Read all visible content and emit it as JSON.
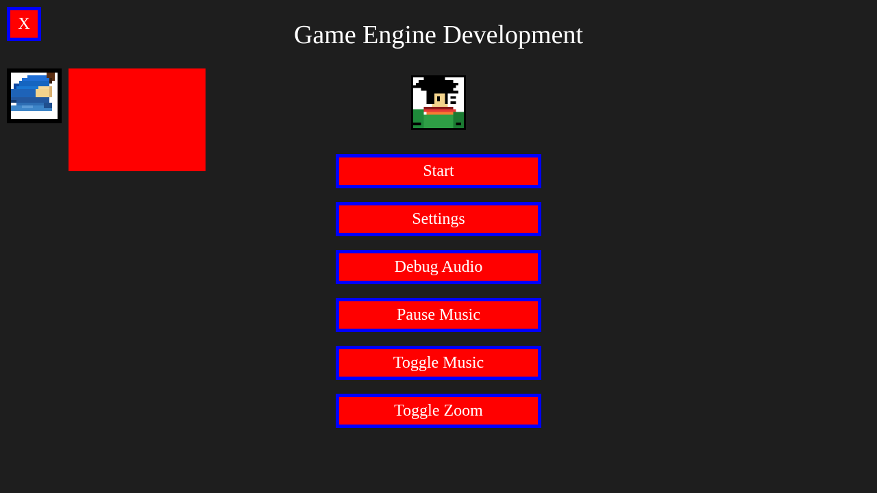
{
  "window": {
    "close_label": "X",
    "title": "Game Engine Development"
  },
  "sprites": {
    "left_icon": "blue-hooded-character-sprite",
    "center_icon": "dark-haired-hero-sprite"
  },
  "menu": {
    "items": [
      {
        "label": "Start"
      },
      {
        "label": "Settings"
      },
      {
        "label": "Debug Audio"
      },
      {
        "label": "Pause Music"
      },
      {
        "label": "Toggle Music"
      },
      {
        "label": "Toggle Zoom"
      }
    ]
  },
  "colors": {
    "background": "#1e1e1e",
    "button_fill": "#ff0000",
    "button_border": "#0000ff",
    "text": "#ffffff"
  }
}
